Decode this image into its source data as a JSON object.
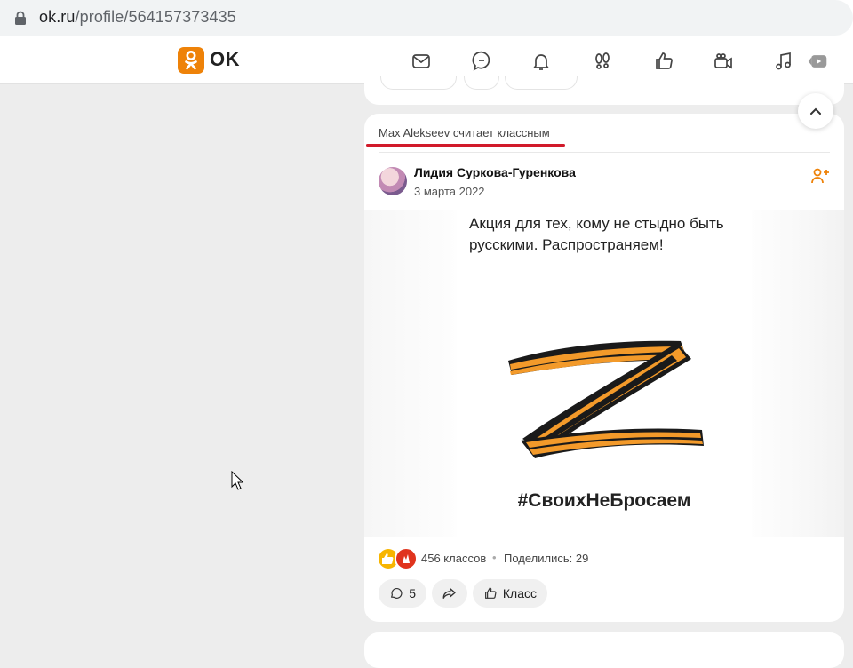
{
  "browser": {
    "url_host": "ok.ru",
    "url_path": "/profile/564157373435"
  },
  "header": {
    "brand": "OK",
    "nav_icons": [
      "mail-icon",
      "discussions-icon",
      "notifications-icon",
      "guests-icon",
      "likes-icon",
      "video-icon",
      "music-icon",
      "video-showcase-icon"
    ]
  },
  "post": {
    "liked_by": "Max Alekseev считает классным",
    "author": "Лидия Суркова-Гуренкова",
    "date": "3 марта 2022",
    "image_caption": "Акция для тех, кому не стыдно быть русскими. Распространяем!",
    "image_hashtag": "#СвоихНеБросаем",
    "klass_count": "456 классов",
    "dot": "•",
    "shared": "Поделились: 29",
    "comments_count": "5",
    "klass_button": "Класс"
  },
  "colors": {
    "ok_orange": "#ee8208",
    "underline_red": "#d11a2a",
    "ribbon_orange": "#f39a2a",
    "ribbon_black": "#1a1a1a"
  }
}
